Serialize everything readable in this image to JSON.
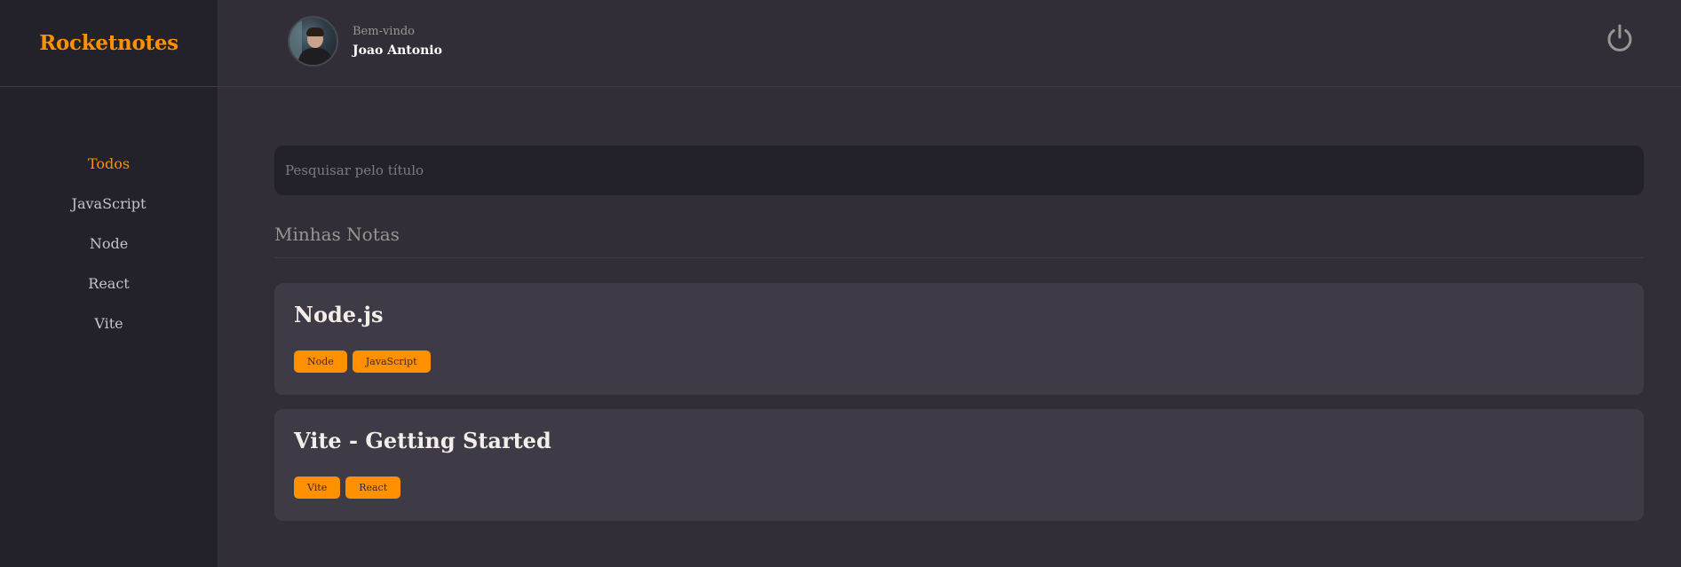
{
  "brand": {
    "name": "Rocketnotes"
  },
  "sidebar": {
    "items": [
      {
        "label": "Todos",
        "active": true
      },
      {
        "label": "JavaScript",
        "active": false
      },
      {
        "label": "Node",
        "active": false
      },
      {
        "label": "React",
        "active": false
      },
      {
        "label": "Vite",
        "active": false
      }
    ]
  },
  "header": {
    "greeting": "Bem-vindo",
    "username": "Joao Antonio",
    "avatar_icon": "user-avatar",
    "logout_icon": "power-icon"
  },
  "search": {
    "placeholder": "Pesquisar pelo título",
    "value": ""
  },
  "main": {
    "section_title": "Minhas Notas",
    "notes": [
      {
        "title": "Node.js",
        "tags": [
          "Node",
          "JavaScript"
        ]
      },
      {
        "title": "Vite - Getting Started",
        "tags": [
          "Vite",
          "React"
        ]
      }
    ]
  },
  "colors": {
    "accent": "#FF9000",
    "background": "#312E38",
    "sidebar": "#232129",
    "card": "#3E3B47"
  }
}
